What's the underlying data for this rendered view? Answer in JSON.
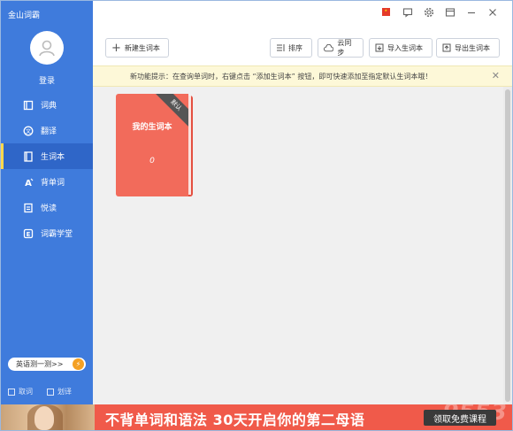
{
  "app": {
    "title": "金山词霸"
  },
  "sidebar": {
    "login_label": "登录",
    "items": [
      {
        "label": "词典",
        "icon": "book-open-icon"
      },
      {
        "label": "翻译",
        "icon": "translate-icon"
      },
      {
        "label": "生词本",
        "icon": "notebook-icon",
        "active": true
      },
      {
        "label": "背单词",
        "icon": "memorize-icon"
      },
      {
        "label": "悦读",
        "icon": "reading-icon"
      },
      {
        "label": "词霸学堂",
        "icon": "classroom-icon"
      }
    ],
    "test_button": "英语测一测>>",
    "bottom": {
      "opt1": "取词",
      "opt2": "划译"
    }
  },
  "toolbar": {
    "new_book": "新建生词本",
    "sort": "排序",
    "sync": "云同步",
    "import": "导入生词本",
    "export": "导出生词本"
  },
  "notice": {
    "text": "新功能提示：在查询单词时，右键点击 “添加生词本” 按钮，即可快速添加至指定默认生词本哦！"
  },
  "wordbook": {
    "title": "我的生词本",
    "count": "0",
    "badge": "默认",
    "color": "#f26b5b"
  },
  "banner": {
    "headline": "不背单词和语法   30天开启你的第二母语",
    "cta": "领取免费课程",
    "watermark": "9553"
  },
  "colors": {
    "sidebar": "#3f7bdc",
    "accent": "#ffd84d"
  }
}
